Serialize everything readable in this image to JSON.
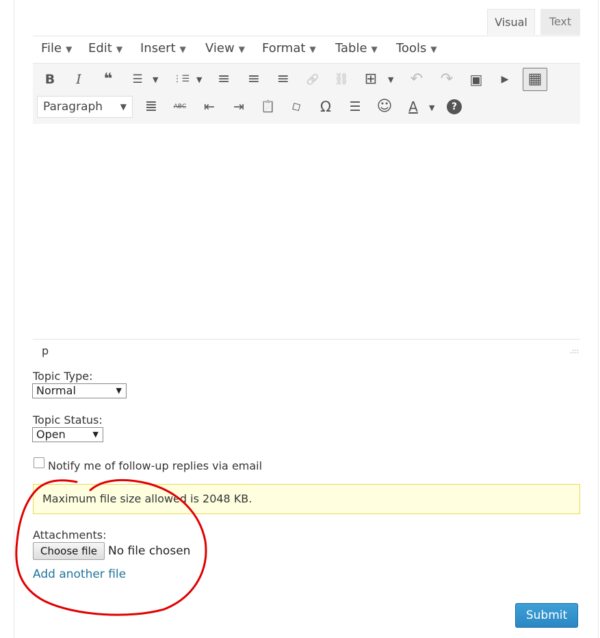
{
  "editor": {
    "tabs": {
      "visual": "Visual",
      "text": "Text"
    },
    "menus": [
      {
        "label": "File"
      },
      {
        "label": "Edit"
      },
      {
        "label": "Insert"
      },
      {
        "label": "View"
      },
      {
        "label": "Format"
      },
      {
        "label": "Table"
      },
      {
        "label": "Tools"
      }
    ],
    "menu_arrow": "▼",
    "toolbar_row1": [
      {
        "icon": "bold-icon",
        "glyph": "B"
      },
      {
        "icon": "italic-icon",
        "glyph": "I"
      },
      {
        "icon": "blockquote-icon",
        "glyph": "❝"
      },
      {
        "icon": "bullet-list-icon",
        "glyph": "☰"
      },
      {
        "icon": "numbered-list-icon",
        "glyph": "⋮☰"
      },
      {
        "icon": "align-left-icon",
        "glyph": "≡"
      },
      {
        "icon": "align-center-icon",
        "glyph": "≡"
      },
      {
        "icon": "align-right-icon",
        "glyph": "≡"
      },
      {
        "icon": "link-icon",
        "glyph": "🔗"
      },
      {
        "icon": "unlink-icon",
        "glyph": "⛓"
      },
      {
        "icon": "table-icon",
        "glyph": "⊞"
      },
      {
        "icon": "undo-icon",
        "glyph": "↶"
      },
      {
        "icon": "redo-icon",
        "glyph": "↷"
      },
      {
        "icon": "image-icon",
        "glyph": "▣"
      },
      {
        "icon": "media-icon",
        "glyph": "▶"
      },
      {
        "icon": "toolbar-toggle-icon",
        "glyph": "▦"
      }
    ],
    "format_select": "Paragraph",
    "toolbar_row2": [
      {
        "icon": "justify-icon",
        "glyph": "≣"
      },
      {
        "icon": "strikethrough-icon",
        "glyph": "ABC"
      },
      {
        "icon": "outdent-icon",
        "glyph": "⇤"
      },
      {
        "icon": "indent-icon",
        "glyph": "⇥"
      },
      {
        "icon": "paste-text-icon",
        "glyph": "📋"
      },
      {
        "icon": "clear-formatting-icon",
        "glyph": "◇"
      },
      {
        "icon": "special-character-icon",
        "glyph": "Ω"
      },
      {
        "icon": "horizontal-line-icon",
        "glyph": "☰"
      },
      {
        "icon": "emoticon-icon",
        "glyph": "☺"
      },
      {
        "icon": "text-color-icon",
        "glyph": "A"
      },
      {
        "icon": "help-icon",
        "glyph": "?"
      }
    ],
    "path": "p",
    "resize_glyph": ".:::"
  },
  "form": {
    "topic_type_label": "Topic Type:",
    "topic_type_value": "Normal",
    "topic_status_label": "Topic Status:",
    "topic_status_value": "Open",
    "notify_label": "Notify me of follow-up replies via email",
    "notice": "Maximum file size allowed is 2048 KB.",
    "attachments_label": "Attachments:",
    "choose_file": "Choose file",
    "file_status": "No file chosen",
    "add_another": "Add another file",
    "submit": "Submit"
  },
  "colors": {
    "annotation": "#e00000",
    "notice_bg": "#ffffe0",
    "notice_border": "#e6db55",
    "link": "#21759b",
    "submit_bg": "#2a87c2"
  }
}
